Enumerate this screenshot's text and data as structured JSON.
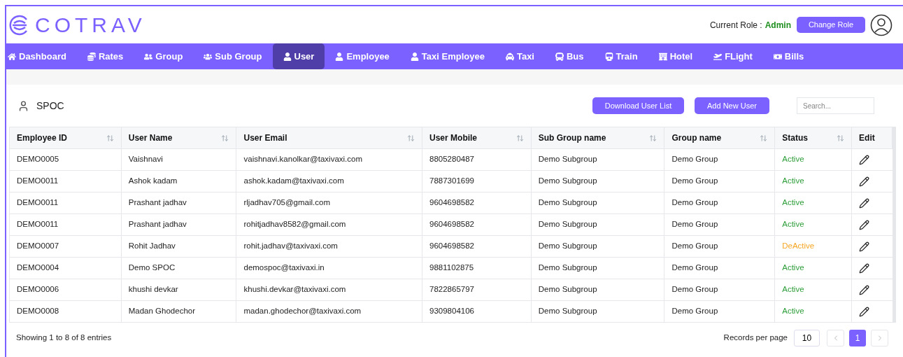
{
  "header": {
    "logo": "COTRAV",
    "role_label": "Current Role :",
    "role": "Admin",
    "change_role": "Change Role"
  },
  "nav": [
    {
      "label": "Dashboard",
      "selected": false
    },
    {
      "label": "Rates",
      "selected": false
    },
    {
      "label": "Group",
      "selected": false
    },
    {
      "label": "Sub Group",
      "selected": false
    },
    {
      "label": "User",
      "selected": true
    },
    {
      "label": "Employee",
      "selected": false
    },
    {
      "label": "Taxi Employee",
      "selected": false
    },
    {
      "label": "Taxi",
      "selected": false
    },
    {
      "label": "Bus",
      "selected": false
    },
    {
      "label": "Train",
      "selected": false
    },
    {
      "label": "Hotel",
      "selected": false
    },
    {
      "label": "FLight",
      "selected": false
    },
    {
      "label": "Bills",
      "selected": false
    }
  ],
  "page": {
    "title": "SPOC",
    "download": "Download User List",
    "add": "Add New User",
    "search_placeholder": "Search..."
  },
  "table": {
    "columns": [
      {
        "label": "Employee ID",
        "sortable": true
      },
      {
        "label": "User Name",
        "sortable": true
      },
      {
        "label": "User Email",
        "sortable": true
      },
      {
        "label": "User Mobile",
        "sortable": true
      },
      {
        "label": "Sub Group name",
        "sortable": true
      },
      {
        "label": "Group name",
        "sortable": true
      },
      {
        "label": "Status",
        "sortable": true
      },
      {
        "label": "Edit",
        "sortable": false
      }
    ],
    "rows": [
      {
        "cells": [
          "DEMO0005",
          "Vaishnavi",
          "vaishnavi.kanolkar@taxivaxi.com",
          "8805280487",
          "Demo Subgroup",
          "Demo Group"
        ],
        "status": "Active",
        "color": "#2e9e3a"
      },
      {
        "cells": [
          "DEMO0011",
          "Ashok kadam",
          "ashok.kadam@taxivaxi.com",
          "7887301699",
          "Demo Subgroup",
          "Demo Group"
        ],
        "status": "Active",
        "color": "#2e9e3a"
      },
      {
        "cells": [
          "DEMO0011",
          "Prashant jadhav",
          "rljadhav705@gmail.com",
          "9604698582",
          "Demo Subgroup",
          "Demo Group"
        ],
        "status": "Active",
        "color": "#2e9e3a"
      },
      {
        "cells": [
          "DEMO0011",
          "Prashant jadhav",
          "rohitjadhav8582@gmail.com",
          "9604698582",
          "Demo Subgroup",
          "Demo Group"
        ],
        "status": "Active",
        "color": "#2e9e3a"
      },
      {
        "cells": [
          "DEMO0007",
          "Rohit Jadhav",
          "rohit.jadhav@taxivaxi.com",
          "9604698582",
          "Demo Subgroup",
          "Demo Group"
        ],
        "status": "DeActive",
        "color": "#f5a623"
      },
      {
        "cells": [
          "DEMO0004",
          "Demo SPOC",
          "demospoc@taxivaxi.in",
          "9881102875",
          "Demo Subgroup",
          "Demo Group"
        ],
        "status": "Active",
        "color": "#2e9e3a"
      },
      {
        "cells": [
          "DEMO0006",
          "khushi devkar",
          "khushi.devkar@taxivaxi.com",
          "7822865797",
          "Demo Subgroup",
          "Demo Group"
        ],
        "status": "Active",
        "color": "#2e9e3a"
      },
      {
        "cells": [
          "DEMO0008",
          "Madan Ghodechor",
          "madan.ghodechor@taxivaxi.com",
          "9309804106",
          "Demo Subgroup",
          "Demo Group"
        ],
        "status": "Active",
        "color": "#2e9e3a"
      }
    ]
  },
  "footer": {
    "summary": "Showing 1 to 8 of 8 entries",
    "records_label": "Records per page",
    "records_value": "10",
    "pages": [
      {
        "label": "1",
        "selected": true
      }
    ]
  }
}
